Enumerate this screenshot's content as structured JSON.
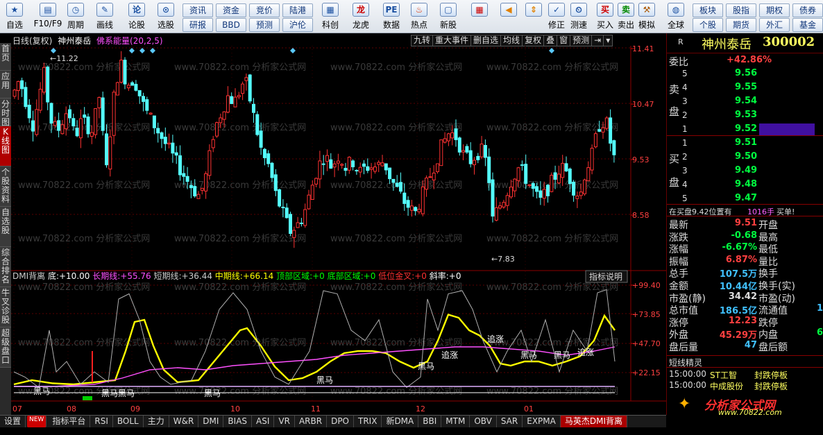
{
  "toolbar": {
    "items": [
      {
        "label": "自选",
        "icon": "star-icon"
      },
      {
        "label": "F10/F9",
        "icon": "f10-icon"
      },
      {
        "label": "周期",
        "icon": "clock-icon"
      },
      {
        "label": "画线",
        "icon": "pen-icon"
      },
      {
        "label": "论股",
        "icon": "discuss-icon"
      },
      {
        "label": "选股",
        "icon": "stock-select-icon"
      }
    ],
    "grid_buttons": [
      [
        "资讯",
        "资金",
        "竞价",
        "陆港"
      ],
      [
        "研报",
        "BBD",
        "预测",
        "沪伦"
      ]
    ],
    "items2": [
      {
        "label": "科创"
      },
      {
        "label": "龙虎"
      },
      {
        "label": "数据"
      },
      {
        "label": "热点"
      },
      {
        "label": "新股"
      }
    ],
    "items3": [
      {
        "label": "修正"
      },
      {
        "label": "测速"
      },
      {
        "label": "买入"
      },
      {
        "label": "卖出"
      },
      {
        "label": "模拟"
      },
      {
        "label": "全球"
      }
    ],
    "right_grid": [
      [
        "板块",
        "股指",
        "期权",
        "债券"
      ],
      [
        "个股",
        "期货",
        "外汇",
        "基金"
      ]
    ]
  },
  "leftnav": [
    "首页",
    "应用",
    "分时图",
    "K线图",
    "个股资料",
    "自选股",
    "综合排名",
    "牛叉诊股",
    "超级盘口"
  ],
  "chart_header": {
    "period": "日线(复权)",
    "stock_name": "神州泰岳",
    "indicator": "佛系能量(20,2,5)"
  },
  "chart_buttons": [
    "九转",
    "重大事件",
    "删自选",
    "均线",
    "复权",
    "叠",
    "窗",
    "预测"
  ],
  "price_axis": [
    "11.41",
    "10.47",
    "9.53",
    "8.58"
  ],
  "price_annotations": {
    "high": "11.22",
    "low": "7.83"
  },
  "watermark": "www.70822.com 分析家公式网",
  "indicator_header": {
    "name": "DMI背离",
    "items": [
      {
        "label": "底:",
        "value": "+10.00"
      },
      {
        "label": "长期线:",
        "value": "+55.76"
      },
      {
        "label": "短期线:",
        "value": "+36.44"
      },
      {
        "label": "中期线:",
        "value": "+66.14"
      },
      {
        "label": "顶部区域:",
        "value": "+0"
      },
      {
        "label": "底部区域:",
        "value": "+0"
      },
      {
        "label": "低位金叉:",
        "value": "+0"
      },
      {
        "label": "斜率:",
        "value": "+0"
      }
    ],
    "explain": "指标说明"
  },
  "indicator_axis": [
    "+99.40",
    "+73.85",
    "+47.70",
    "+22.15"
  ],
  "indicator_labels": [
    "黑马",
    "黑马黑马",
    "黑马",
    "黑马",
    "黑马",
    "追涨",
    "追涨",
    "黑马",
    "黑马",
    "追涨"
  ],
  "time_axis": [
    "07",
    "08",
    "09",
    "10",
    "11",
    "12",
    "01"
  ],
  "bottom_tabs": [
    "设置",
    "指标平台",
    "RSI",
    "BOLL",
    "主力",
    "W&R",
    "DMI",
    "BIAS",
    "ASI",
    "VR",
    "ARBR",
    "DPO",
    "TRIX",
    "新DMA",
    "BBI",
    "MTM",
    "OBV",
    "SAR",
    "EXPMA",
    "马英杰DMI背离"
  ],
  "bottom_new": "NEW",
  "right_panel": {
    "R": "R",
    "stock_title": "神州泰岳",
    "stock_code": "300002",
    "weibi_label": "委比",
    "weibi_value": "+42.86%",
    "sell_label": [
      "卖",
      "盘"
    ],
    "buy_label": [
      "买",
      "盘"
    ],
    "sell": [
      {
        "level": "5",
        "price": "9.56"
      },
      {
        "level": "4",
        "price": "9.55"
      },
      {
        "level": "3",
        "price": "9.54"
      },
      {
        "level": "2",
        "price": "9.53"
      },
      {
        "level": "1",
        "price": "9.52"
      }
    ],
    "buy": [
      {
        "level": "1",
        "price": "9.51"
      },
      {
        "level": "2",
        "price": "9.50"
      },
      {
        "level": "3",
        "price": "9.49"
      },
      {
        "level": "4",
        "price": "9.48"
      },
      {
        "level": "5",
        "price": "9.47"
      }
    ],
    "position_text": "在买盘9.42位置有",
    "position_count": "1016手",
    "position_action": "买单!",
    "stats": [
      {
        "l": "最新",
        "v": "9.51",
        "r": "开盘"
      },
      {
        "l": "涨跌",
        "v": "-0.68",
        "r": "最高"
      },
      {
        "l": "涨幅",
        "v": "-6.67%",
        "r": "最低"
      },
      {
        "l": "振幅",
        "v": "6.87%",
        "r": "量比"
      },
      {
        "l": "总手",
        "v": "107.5万",
        "r": "换手"
      },
      {
        "l": "金额",
        "v": "10.44亿",
        "r": "换手(实)"
      },
      {
        "l": "市盈(静)",
        "v": "34.42",
        "r": "市盈(动)"
      },
      {
        "l": "总市值",
        "v": "186.5亿",
        "r": "流通值"
      },
      {
        "l": "涨停",
        "v": "12.23",
        "r": "跌停"
      },
      {
        "l": "外盘",
        "v": "45.29万",
        "r": "内盘"
      },
      {
        "l": "盘后量",
        "v": "47",
        "r": "盘后额"
      }
    ],
    "stats_extra": {
      "liutong": "1",
      "neipan": "6"
    },
    "short_title": "短线精灵",
    "short_items": [
      {
        "time": "15:00:00",
        "name": "ST工智",
        "event": "封跌停板"
      },
      {
        "time": "15:00:00",
        "name": "中成股份",
        "event": "封跌停板"
      }
    ],
    "logo_text": "分析家公式网",
    "logo_url": "www.70822.com"
  },
  "colors": {
    "up": "#ff3232",
    "down": "#54fcfc",
    "yellow": "#ffff00",
    "pink": "#ff50ff"
  }
}
